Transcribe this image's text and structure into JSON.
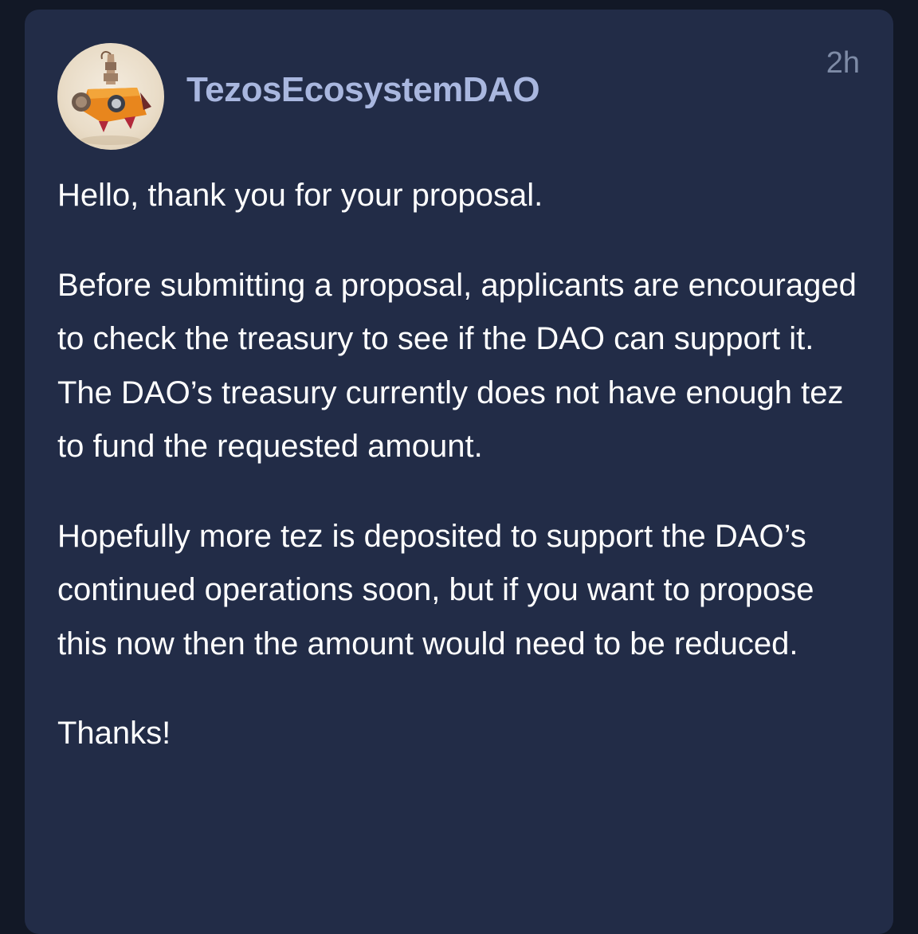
{
  "post": {
    "author": "TezosEcosystemDAO",
    "timestamp": "2h",
    "avatar_icon": "robot-rocket-avatar",
    "paragraphs": [
      "Hello, thank you for your proposal.",
      "Before submitting a proposal, applicants are encouraged to check the treasury to see if the DAO can support it. The DAO’s treasury currently does not have enough tez to fund the requested amount.",
      "Hopefully more tez is deposited to support the DAO’s continued operations soon, but if you want to propose this now then the amount would need to be reduced.",
      "Thanks!"
    ]
  },
  "colors": {
    "background": "#121826",
    "card": "#222c47",
    "author": "#a9b7df",
    "timestamp": "#7e8ba6",
    "text": "#ffffff"
  }
}
